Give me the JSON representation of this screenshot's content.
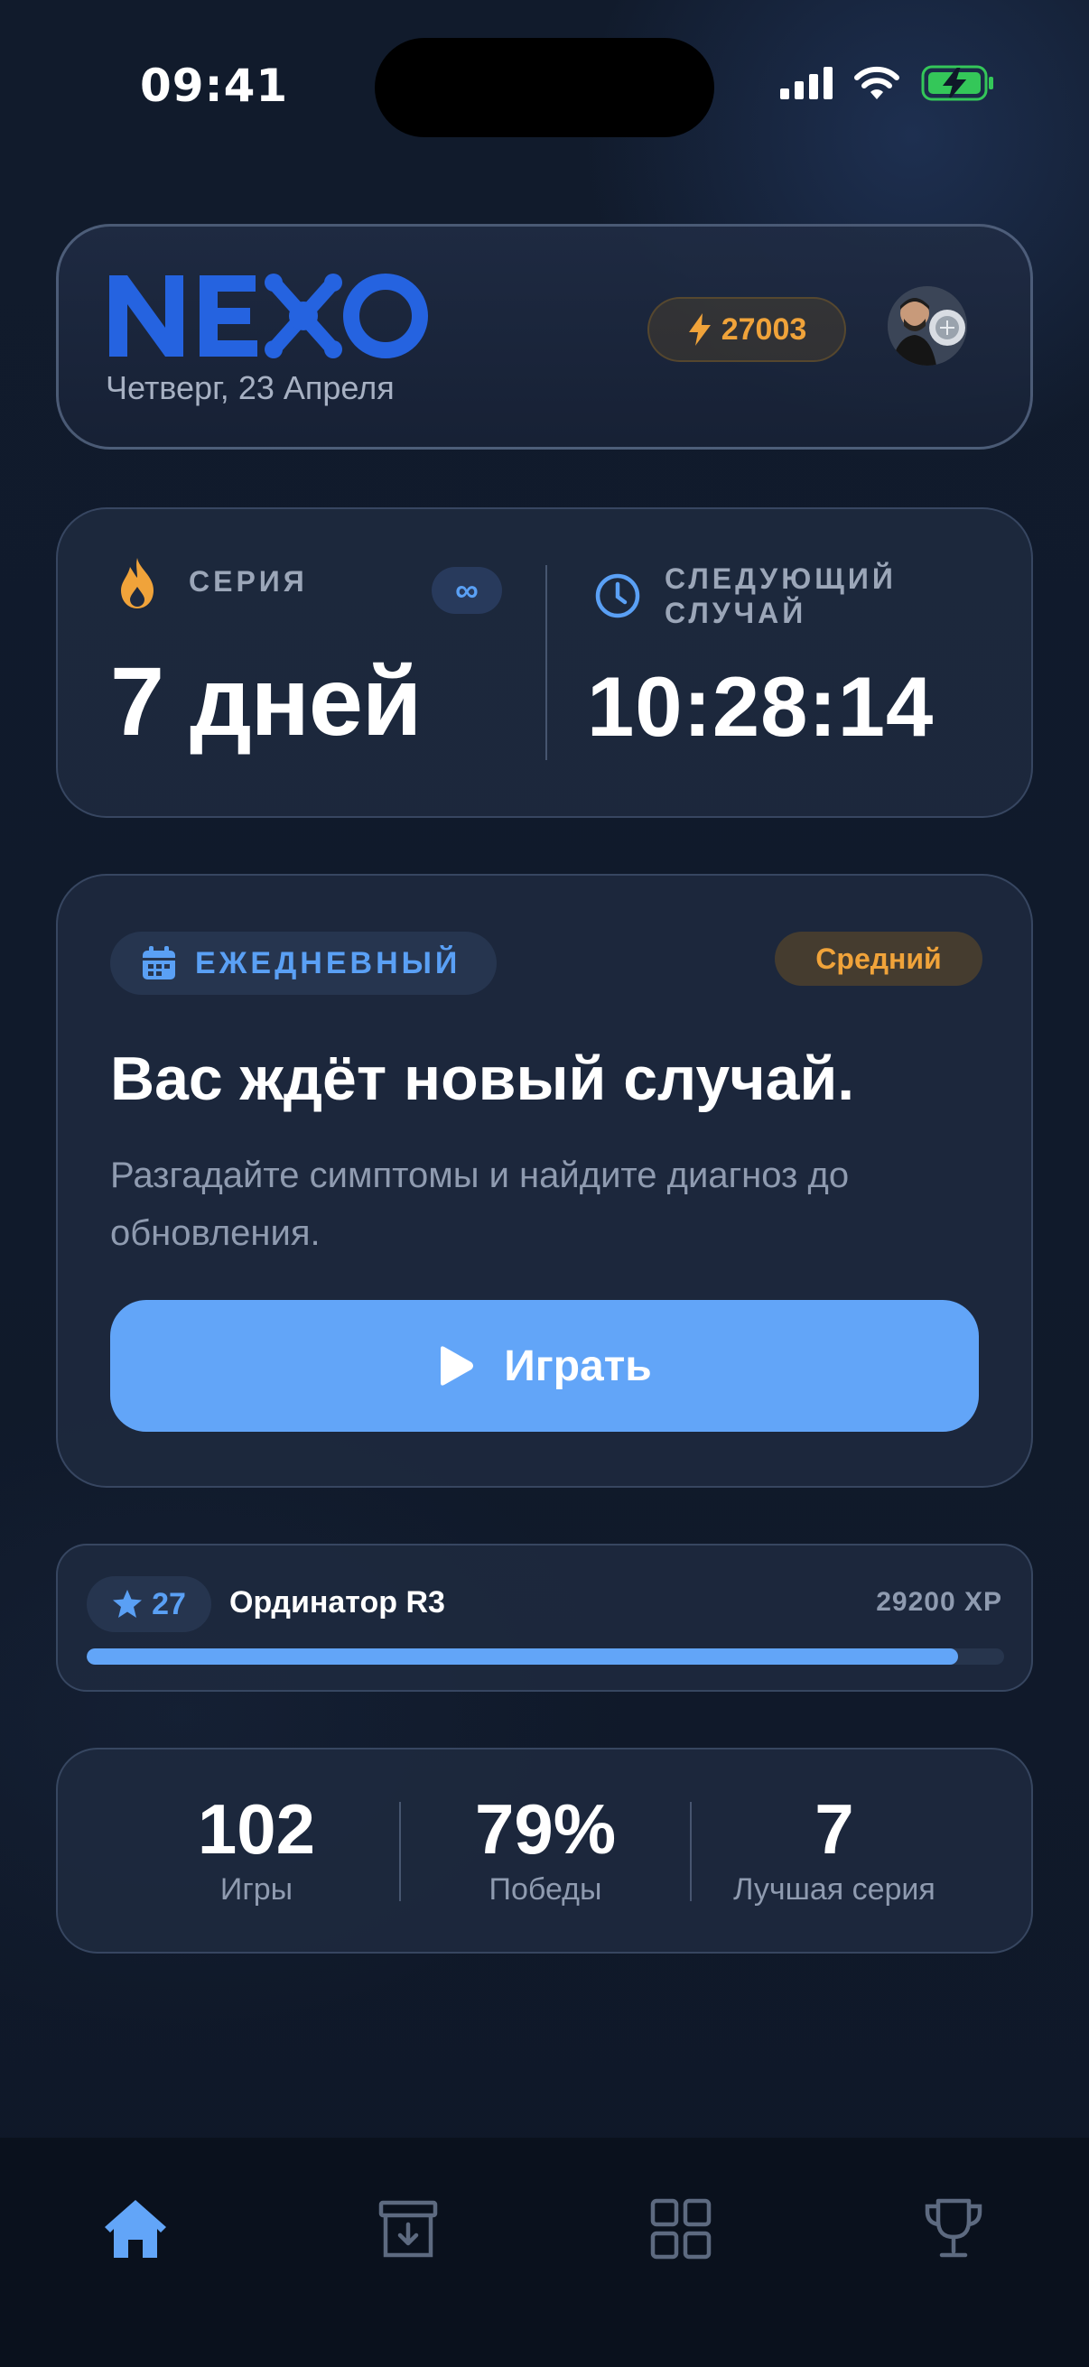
{
  "status_bar": {
    "time": "09:41"
  },
  "header": {
    "logo_text": "NEXO",
    "date": "Четверг, 23 Апреля",
    "xp_points": "27003"
  },
  "streak": {
    "label": "СЕРИЯ",
    "value": "7 дней",
    "badge": "∞",
    "next_label": "СЛЕДУЮЩИЙ СЛУЧАЙ",
    "timer": "10:28:14"
  },
  "daily": {
    "badge_label": "ЕЖЕДНЕВНЫЙ",
    "difficulty": "Средний",
    "title": "Вас ждёт новый случай.",
    "description": "Разгадайте симптомы и найдите диагноз до обновления.",
    "play_label": "Играть"
  },
  "level": {
    "number": "27",
    "rank": "Ординатор R3",
    "xp_total": "29200 XP",
    "progress_fraction": 0.95
  },
  "stats": [
    {
      "value": "102",
      "label": "Игры"
    },
    {
      "value": "79%",
      "label": "Победы"
    },
    {
      "value": "7",
      "label": "Лучшая серия"
    }
  ],
  "tabs": [
    {
      "icon": "home-icon",
      "active": true
    },
    {
      "icon": "archive-icon",
      "active": false
    },
    {
      "icon": "grid-icon",
      "active": false
    },
    {
      "icon": "trophy-icon",
      "active": false
    }
  ],
  "colors": {
    "accent": "#62a5f8",
    "logo_blue": "#2563e0",
    "warning": "#f0a33a",
    "battery_green": "#34c759"
  }
}
